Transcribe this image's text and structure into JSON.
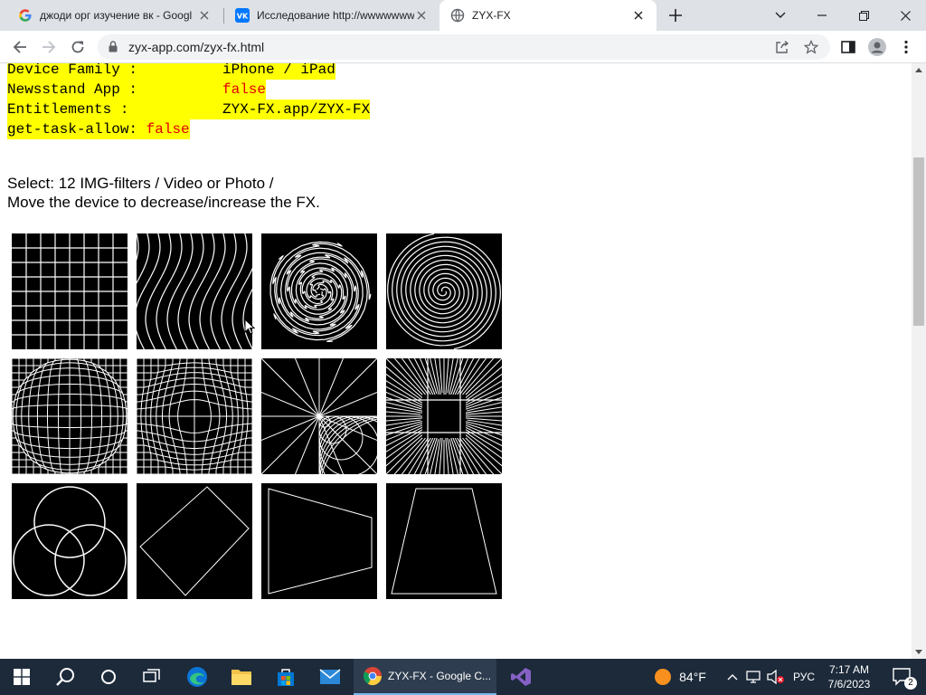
{
  "browser": {
    "tabs": [
      {
        "title": "джоди орг изучение вк - Googl",
        "icon": "google-icon"
      },
      {
        "title": "Исследование http://wwwwwww",
        "icon": "vk-icon"
      },
      {
        "title": "ZYX-FX",
        "icon": "globe-icon"
      }
    ],
    "url": "zyx-app.com/zyx-fx.html"
  },
  "info": {
    "rows": [
      {
        "key": "Device Family :",
        "value": "iPhone / iPad",
        "red": false
      },
      {
        "key": "Newsstand App :",
        "value": "false",
        "red": true
      },
      {
        "key": "Entitlements :",
        "value": "ZYX-FX.app/ZYX-FX",
        "red": false
      },
      {
        "key": "get-task-allow:",
        "value": "false",
        "red": true
      }
    ]
  },
  "description": {
    "line1": "Select: 12 IMG-filters / Video or Photo /",
    "line2": "Move the device to decrease/increase the FX."
  },
  "filters": [
    "grid",
    "wave",
    "swirl-small",
    "spiral",
    "bulge",
    "pinch",
    "polar",
    "radial-lines",
    "circles",
    "diamond",
    "trapezoid-left",
    "trapezoid-up"
  ],
  "taskbar": {
    "chrome_label": "ZYX-FX - Google C...",
    "weather": "84°F",
    "language": "РУС",
    "time": "7:17 AM",
    "date": "7/6/2023",
    "notification_count": "2"
  },
  "colors": {
    "highlight": "#ffff00",
    "red_value": "#e00000",
    "taskbar": "#1c2a3a"
  }
}
